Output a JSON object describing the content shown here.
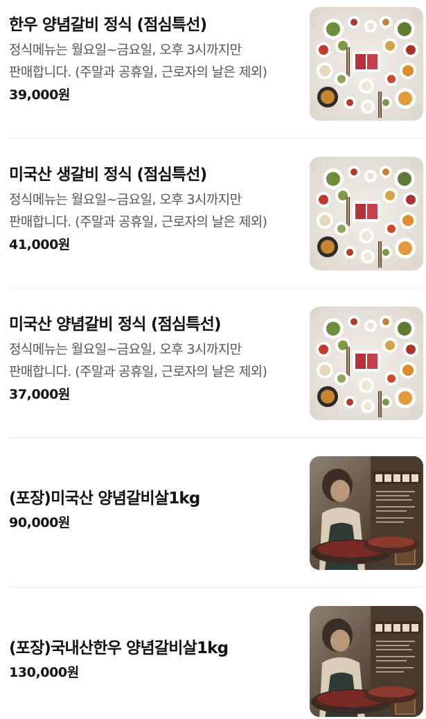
{
  "menu_items": [
    {
      "name": "한우 양념갈비 정식 (점심특선)",
      "description": "정식메뉴는 월요일~금요일, 오후 3시까지만 판매합니다. (주말과 공휴일, 근로자의 날은 제외)",
      "price": "39,000원",
      "image_icon": "table-spread-photo"
    },
    {
      "name": "미국산 생갈비 정식 (점심특선)",
      "description": "정식메뉴는 월요일~금요일, 오후 3시까지만 판매합니다. (주말과 공휴일, 근로자의 날은 제외)",
      "price": "41,000원",
      "image_icon": "table-spread-photo"
    },
    {
      "name": "미국산 양념갈비 정식 (점심특선)",
      "description": "정식메뉴는 월요일~금요일, 오후 3시까지만 판매합니다. (주말과 공휴일, 근로자의 날은 제외)",
      "price": "37,000원",
      "image_icon": "table-spread-photo"
    },
    {
      "name": "(포장)미국산 양념갈비살1kg",
      "price": "90,000원",
      "image_icon": "poster-photo"
    },
    {
      "name": "(포장)국내산한우 양념갈비살1kg",
      "price": "130,000원",
      "image_icon": "poster-photo"
    }
  ],
  "colors": {
    "text": "#111111",
    "description": "#555555",
    "divider": "#eeeeee"
  }
}
